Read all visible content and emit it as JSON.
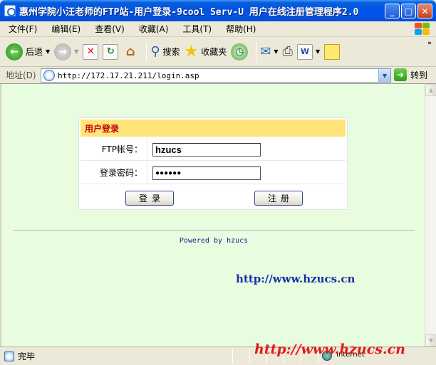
{
  "window": {
    "title": "惠州学院小汪老师的FTP站-用户登录-9cool Serv-U 用户在线注册管理程序2.0",
    "minimize_symbol": "_",
    "maximize_symbol": "□",
    "close_symbol": "✕"
  },
  "menu": [
    "文件(F)",
    "编辑(E)",
    "查看(V)",
    "收藏(A)",
    "工具(T)",
    "帮助(H)"
  ],
  "toolbar": {
    "back_label": "后退",
    "search_label": "搜索",
    "favorites_label": "收藏夹",
    "more": "»"
  },
  "address": {
    "label": "地址(D)",
    "url": "http://172.17.21.211/login.asp",
    "go_label": "转到"
  },
  "login": {
    "header": "用户登录",
    "username_label": "FTP帐号：",
    "username_value": "hzucs",
    "password_label": "登录密码：",
    "password_value": "●●●●●●",
    "login_button": "登录",
    "register_button": "注册"
  },
  "footer": {
    "powered": "Powered by hzucs",
    "site_link": "http://www.hzucs.cn"
  },
  "status": {
    "text": "完毕",
    "zone": "Internet"
  },
  "watermark": "http://www.hzucs.cn",
  "colors": {
    "content_bg": "#e8fde0",
    "login_header_bg": "#ffe47a",
    "login_header_text": "#c00000",
    "link": "#1a2ea8",
    "watermark": "#e21a1a"
  }
}
